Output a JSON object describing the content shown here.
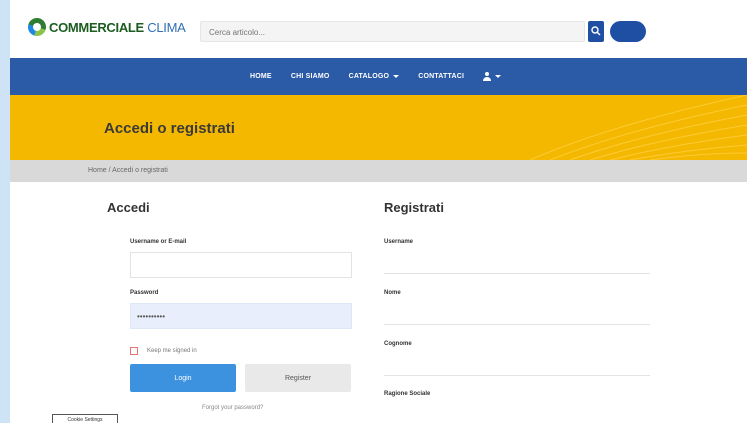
{
  "header": {
    "logo_word1": "COMMERCIALE",
    "logo_word2": "CLIMA",
    "search_placeholder": "Cerca articolo...",
    "search_icon": "search-icon"
  },
  "nav": {
    "items": [
      {
        "label": "HOME",
        "dropdown": false
      },
      {
        "label": "CHI SIAMO",
        "dropdown": false
      },
      {
        "label": "CATALOGO",
        "dropdown": true
      },
      {
        "label": "CONTATTACI",
        "dropdown": false
      }
    ],
    "account_icon": "user-icon"
  },
  "banner": {
    "title": "Accedi o registrati",
    "color": "#f5b800"
  },
  "breadcrumb": "Home / Accedi o registrati",
  "login": {
    "heading": "Accedi",
    "username_label": "Username or E-mail",
    "username_value": "",
    "password_label": "Password",
    "password_value": "••••••••••",
    "remember_label": "Keep me signed in",
    "login_button": "Login",
    "register_button": "Register",
    "forgot_link": "Forgot your password?"
  },
  "register": {
    "heading": "Registrati",
    "fields": [
      {
        "label": "Username"
      },
      {
        "label": "Nome"
      },
      {
        "label": "Cognome"
      },
      {
        "label": "Ragione Sociale"
      }
    ]
  },
  "cookie_button": "Cookie Settings",
  "colors": {
    "nav": "#2b5aa6",
    "primary_button": "#3d92e0",
    "brand_green": "#1b5e20"
  }
}
